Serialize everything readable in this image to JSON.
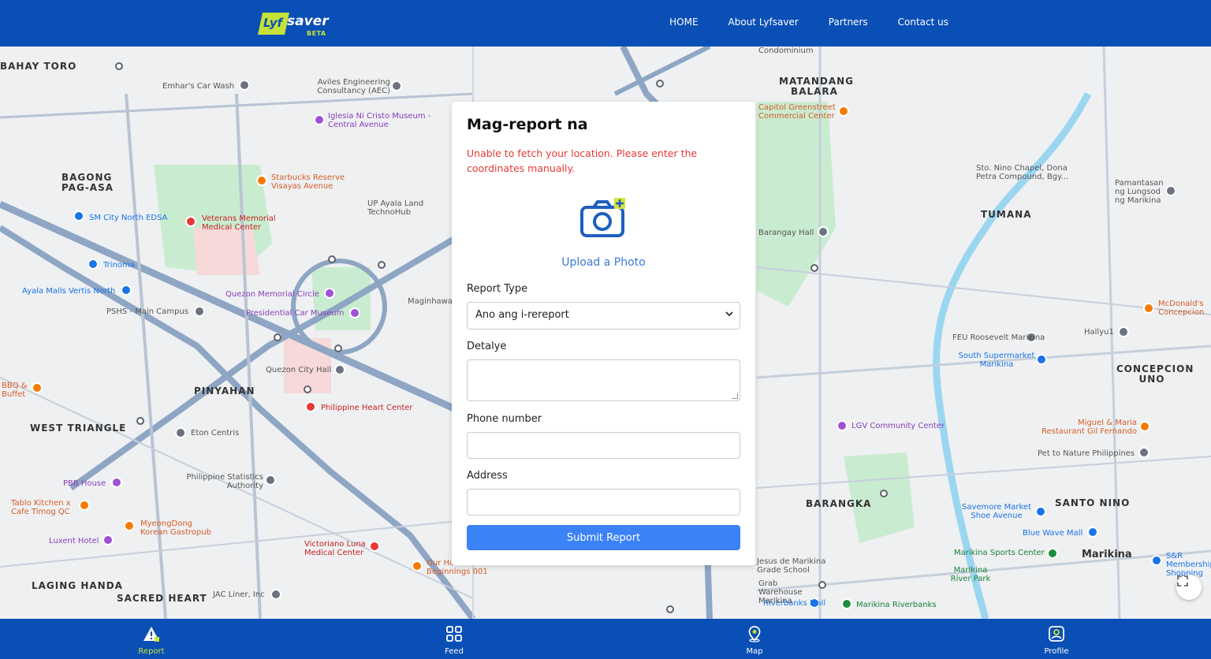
{
  "header": {
    "logo_badge": "Lyf",
    "logo_word": "saver",
    "logo_tag": "BETA",
    "nav": [
      "HOME",
      "About Lyfsaver",
      "Partners",
      "Contact us"
    ]
  },
  "map": {
    "districts": [
      "BAHAY TORO",
      "BAGONG PAG-ASA",
      "PINYAHAN",
      "WEST TRIANGLE",
      "LAGING HANDA",
      "SACRED HEART",
      "MATANDANG BALARA",
      "TUMANA",
      "CONCEPCION UNO",
      "BARANGKA",
      "SANTO NINO",
      "Marikina"
    ],
    "places": [
      "Emhar's Car Wash",
      "Aviles Engineering Consultancy (AEC)",
      "Iglesia Ni Cristo Museum - Central Avenue",
      "Starbucks Reserve Visayas Avenue",
      "Veterans Memorial Medical Center",
      "SM City North EDSA",
      "Trinoma",
      "Ayala Malls Vertis North",
      "PSHS - Main Campus",
      "Quezon Memorial Circle",
      "Presidential Car Museum",
      "Quezon City Hall",
      "Philippine Heart Center",
      "Eton Centris",
      "PBB House",
      "Philippine Statistics Authority",
      "Tablo Kitchen x Cafe Timog QC",
      "MyeongDong Korean Gastropub",
      "Luxent Hotel",
      "Victoriano Luna Medical Center",
      "JAC Liner, Inc",
      "Capitol Greenstreet Commercial Center",
      "Barangay Hall",
      "Sto. Nino Chapel, Dona Petra Compound, Bgy...",
      "Pamantasan ng Lungsod ng Marikina",
      "FEU Roosevelt Marikina",
      "South Supermarket Marikina",
      "LGV Community Center",
      "McDonald's Concepcion",
      "Miguel & Maria Restaurant Gil Fernando",
      "Pet to Nature Philippines",
      "Savemore Market Shoe Avenue",
      "Blue Wave Mall",
      "Marikina Sports Center",
      "Marikina River Park",
      "Marikina Riverbanks",
      "Riverbanks Mall",
      "Grab Warehouse Marikina",
      "Jesus de Marikina Grade School",
      "S&R Membership Shopping",
      "UP Ayala Land TechnoHub",
      "Condominium",
      "Hallyu1",
      "Maginhawa",
      "Our Humble Beginnings 001",
      "BBQ & Buffet"
    ]
  },
  "card": {
    "title": "Mag-report na",
    "error": "Unable to fetch your location. Please enter the coordinates manually.",
    "upload_label": "Upload a Photo",
    "report_type_label": "Report Type",
    "report_type_value": "Ano ang i-rereport",
    "detail_label": "Detalye",
    "phone_label": "Phone number",
    "address_label": "Address",
    "submit_label": "Submit Report"
  },
  "bottom_nav": [
    {
      "label": "Report",
      "icon": "warning-icon",
      "active": true
    },
    {
      "label": "Feed",
      "icon": "grid-icon",
      "active": false
    },
    {
      "label": "Map",
      "icon": "map-pin-icon",
      "active": false
    },
    {
      "label": "Profile",
      "icon": "profile-icon",
      "active": false
    }
  ],
  "colors": {
    "brand_blue": "#0a4fb5",
    "accent_lime": "#c7e236",
    "button_blue": "#3b82f6",
    "error_red": "#e53935"
  }
}
